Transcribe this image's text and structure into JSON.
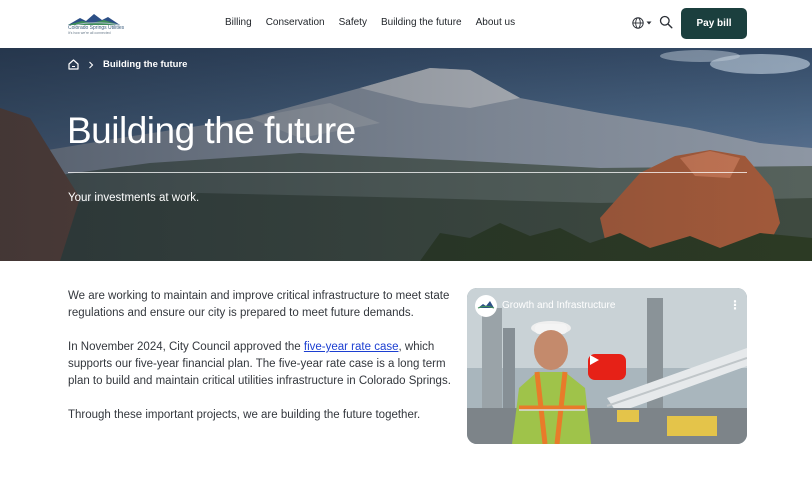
{
  "header": {
    "logo_name": "Colorado Springs Utilities",
    "logo_tagline": "It's how we're all connected",
    "nav": [
      "Billing",
      "Conservation",
      "Safety",
      "Building the future",
      "About us"
    ],
    "language_icon": "globe-icon",
    "search_icon": "search-icon",
    "pay_bill_label": "Pay bill"
  },
  "hero": {
    "breadcrumb_home_icon": "home-icon",
    "breadcrumb_current": "Building the future",
    "title": "Building the future",
    "subtitle": "Your investments at work."
  },
  "content": {
    "p1": "We are working to maintain and  improve critical infrastructure to meet state regulations and ensure our city is prepared to meet future demands.",
    "p2_before": "In November 2024, City Council approved the ",
    "p2_link": "five-year rate case",
    "p2_after": ", which supports our five-year financial plan. The five-year rate case is a long term plan to build and maintain critical utilities infrastructure in Colorado Springs.",
    "p3": "Through these important projects, we are building the future together."
  },
  "video": {
    "title": "Growth and Infrastructure",
    "play_icon": "play-icon",
    "menu_icon": "more-vertical-icon"
  },
  "colors": {
    "brand_dark": "#1b3f3e",
    "link": "#1c3fd1",
    "play": "#e62117"
  }
}
